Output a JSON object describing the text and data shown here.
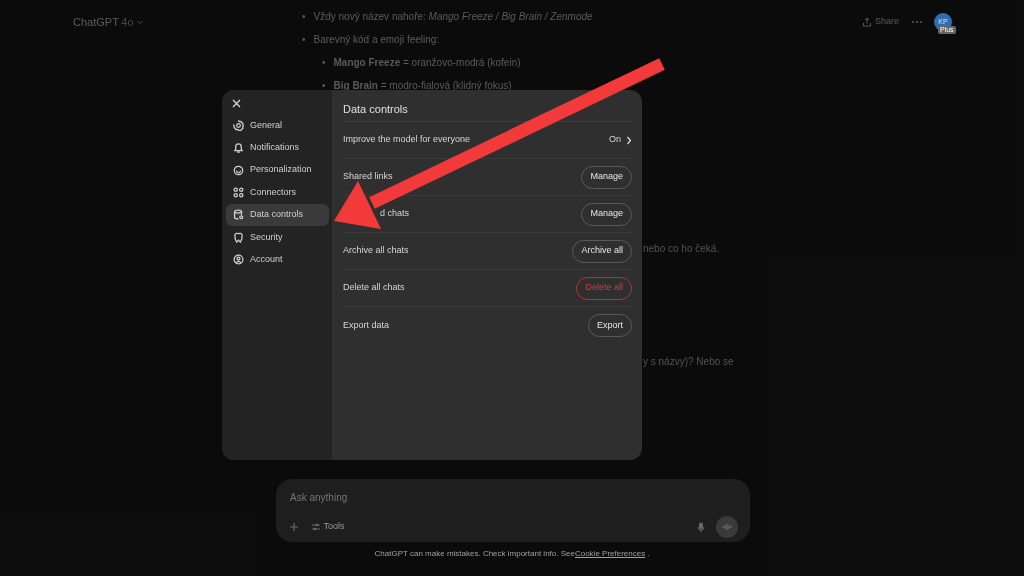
{
  "header": {
    "model": "ChatGPT",
    "version": "4o",
    "share": "Share",
    "avatar": "KP",
    "plan": "Plus"
  },
  "chat": {
    "bullets": [
      {
        "marker": "•",
        "html": "Vždy nový název nahoře: *Mango Freeze / Big Brain / Zenmode*"
      },
      {
        "marker": "•",
        "html": "Barevný kód a emoji feeling:",
        "children": [
          {
            "marker": "•",
            "html": "**Mango Freeze** = oranžovo-modrá (kofein)"
          },
          {
            "marker": "•",
            "html": "**Big Brain** = modro-fialová (klidný fokus)"
          }
        ]
      }
    ],
    "fragments": [
      "nebo co ho čeká.",
      "y s názvy)? Nebo se"
    ]
  },
  "settings": {
    "title": "Data controls",
    "nav": [
      {
        "label": "General",
        "selected": false
      },
      {
        "label": "Notifications",
        "selected": false
      },
      {
        "label": "Personalization",
        "selected": false
      },
      {
        "label": "Connectors",
        "selected": false
      },
      {
        "label": "Data controls",
        "selected": true
      },
      {
        "label": "Security",
        "selected": false
      },
      {
        "label": "Account",
        "selected": false
      }
    ],
    "rows": [
      {
        "label": "Improve the model for everyone",
        "kind": "link",
        "value": "On"
      },
      {
        "label": "Shared links",
        "kind": "button",
        "value": "Manage",
        "danger": false
      },
      {
        "label": "d chats",
        "kind": "button",
        "value": "Manage",
        "danger": false,
        "covered": true
      },
      {
        "label": "Archive all chats",
        "kind": "button",
        "value": "Archive all",
        "danger": false
      },
      {
        "label": "Delete all chats",
        "kind": "button",
        "value": "Delete all",
        "danger": true
      },
      {
        "label": "Export data",
        "kind": "button",
        "value": "Export",
        "danger": false
      }
    ]
  },
  "composer": {
    "placeholder": "Ask anything",
    "tools": "Tools"
  },
  "footer": {
    "text": "ChatGPT can make mistakes. Check important info. See",
    "link": "Cookie Preferences",
    "end": "."
  }
}
